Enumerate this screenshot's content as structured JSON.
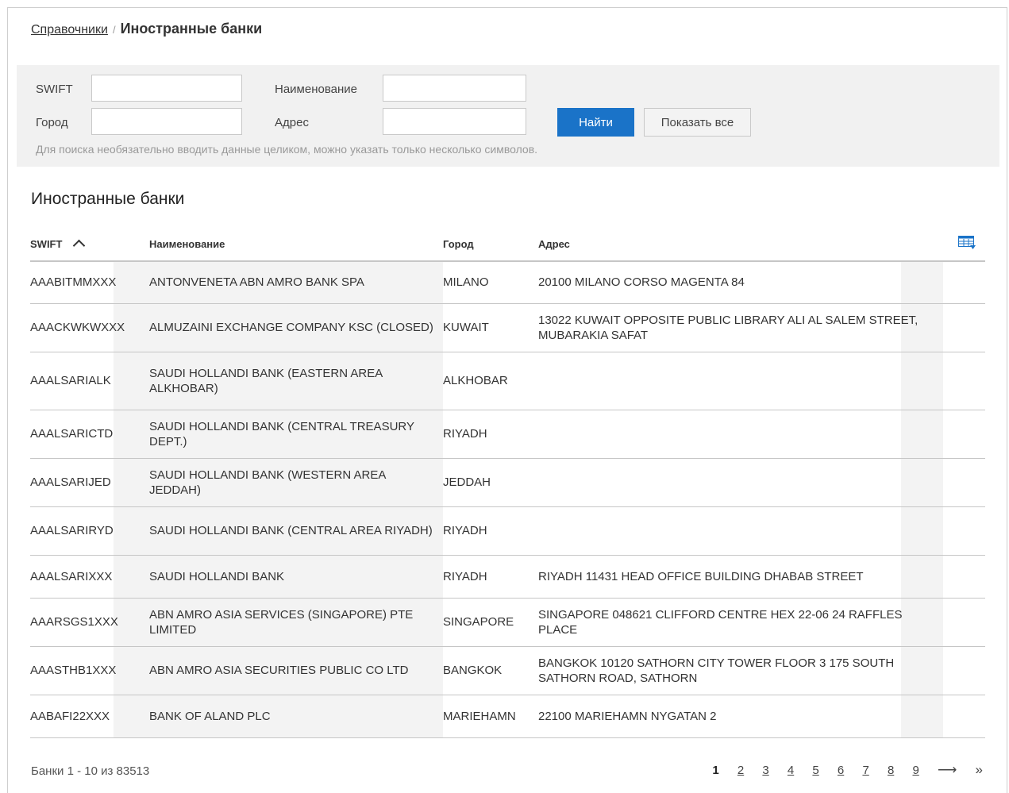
{
  "breadcrumb": {
    "parent": "Справочники",
    "separator": "/",
    "current": "Иностранные банки"
  },
  "filter": {
    "swift_label": "SWIFT",
    "name_label": "Наименование",
    "city_label": "Город",
    "address_label": "Адрес",
    "swift_value": "",
    "name_value": "",
    "city_value": "",
    "address_value": "",
    "find_button": "Найти",
    "show_all_button": "Показать все",
    "hint": "Для поиска необязательно вводить данные целиком, можно указать только несколько символов."
  },
  "section_title": "Иностранные банки",
  "table": {
    "headers": {
      "swift": "SWIFT",
      "name": "Наименование",
      "city": "Город",
      "address": "Адрес"
    },
    "sort": {
      "column": "swift",
      "direction": "ascending"
    },
    "rows": [
      {
        "swift": "AAABITMMXXX",
        "name": "ANTONVENETA ABN AMRO BANK SPA",
        "city": "MILANO",
        "address": "20100 MILANO CORSO MAGENTA 84"
      },
      {
        "swift": "AAACKWKWXXX",
        "name": "ALMUZAINI EXCHANGE COMPANY KSC (CLOSED)",
        "city": "KUWAIT",
        "address": "13022 KUWAIT OPPOSITE PUBLIC LIBRARY ALI AL SALEM STREET, MUBARAKIA SAFAT"
      },
      {
        "swift": "AAALSARIALK",
        "name": "SAUDI HOLLANDI BANK (EASTERN AREA ALKHOBAR)",
        "city": "ALKHOBAR",
        "address": ""
      },
      {
        "swift": "AAALSARICTD",
        "name": "SAUDI HOLLANDI BANK (CENTRAL TREASURY DEPT.)",
        "city": "RIYADH",
        "address": ""
      },
      {
        "swift": "AAALSARIJED",
        "name": "SAUDI HOLLANDI BANK (WESTERN AREA JEDDAH)",
        "city": "JEDDAH",
        "address": ""
      },
      {
        "swift": "AAALSARIRYD",
        "name": "SAUDI HOLLANDI BANK (CENTRAL AREA RIYADH)",
        "city": "RIYADH",
        "address": ""
      },
      {
        "swift": "AAALSARIXXX",
        "name": "SAUDI HOLLANDI BANK",
        "city": "RIYADH",
        "address": "RIYADH 11431 HEAD OFFICE BUILDING DHABAB STREET"
      },
      {
        "swift": "AAARSGS1XXX",
        "name": "ABN AMRO ASIA SERVICES (SINGAPORE) PTE LIMITED",
        "city": "SINGAPORE",
        "address": "SINGAPORE 048621 CLIFFORD CENTRE HEX 22-06 24 RAFFLES PLACE"
      },
      {
        "swift": "AAASTHB1XXX",
        "name": "ABN AMRO ASIA SECURITIES PUBLIC CO LTD",
        "city": "BANGKOK",
        "address": "BANGKOK 10120 SATHORN CITY TOWER FLOOR 3 175 SOUTH SATHORN ROAD, SATHORN"
      },
      {
        "swift": "AABAFI22XXX",
        "name": "BANK OF ALAND PLC",
        "city": "MARIEHAMN",
        "address": "22100 MARIEHAMN NYGATAN 2"
      }
    ]
  },
  "footer": {
    "count_text": "Банки 1 - 10 из 83513",
    "pages": [
      "1",
      "2",
      "3",
      "4",
      "5",
      "6",
      "7",
      "8",
      "9"
    ],
    "current_page": "1",
    "next_label": "⟶",
    "last_label": "»"
  },
  "icons": {
    "columns_settings": "column-settings-icon"
  },
  "colors": {
    "accent": "#1a73c8",
    "filter_bg": "#f1f1f1",
    "row_shade": "#f3f3f3"
  }
}
